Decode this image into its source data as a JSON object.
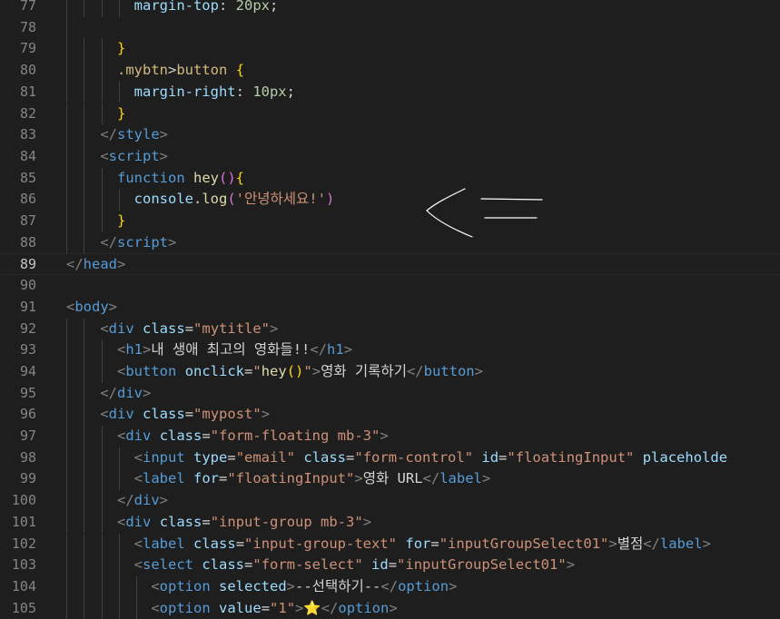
{
  "editor": {
    "active_line": 89,
    "lines": [
      {
        "n": "77",
        "tokens": [
          [
            "        ",
            "t-text"
          ],
          [
            "margin-top",
            "t-prop"
          ],
          [
            ": ",
            "t-text"
          ],
          [
            "20px",
            "t-num"
          ],
          [
            ";",
            "t-text"
          ]
        ]
      },
      {
        "n": "78",
        "tokens": []
      },
      {
        "n": "79",
        "tokens": [
          [
            "      ",
            "t-text"
          ],
          [
            "}",
            "t-brace"
          ]
        ]
      },
      {
        "n": "80",
        "tokens": [
          [
            "      ",
            "t-text"
          ],
          [
            ".mybtn",
            "t-sel"
          ],
          [
            ">",
            "t-text"
          ],
          [
            "button",
            "t-sel"
          ],
          [
            " ",
            "t-text"
          ],
          [
            "{",
            "t-brace"
          ]
        ]
      },
      {
        "n": "81",
        "tokens": [
          [
            "        ",
            "t-text"
          ],
          [
            "margin-right",
            "t-prop"
          ],
          [
            ": ",
            "t-text"
          ],
          [
            "10px",
            "t-num"
          ],
          [
            ";",
            "t-text"
          ]
        ]
      },
      {
        "n": "82",
        "tokens": [
          [
            "      ",
            "t-text"
          ],
          [
            "}",
            "t-brace"
          ]
        ]
      },
      {
        "n": "83",
        "tokens": [
          [
            "    ",
            "t-text"
          ],
          [
            "</",
            "t-punc"
          ],
          [
            "style",
            "t-tag"
          ],
          [
            ">",
            "t-punc"
          ]
        ]
      },
      {
        "n": "84",
        "tokens": [
          [
            "    ",
            "t-text"
          ],
          [
            "<",
            "t-punc"
          ],
          [
            "script",
            "t-tag"
          ],
          [
            ">",
            "t-punc"
          ]
        ]
      },
      {
        "n": "85",
        "tokens": [
          [
            "      ",
            "t-text"
          ],
          [
            "function",
            "t-kw"
          ],
          [
            " ",
            "t-text"
          ],
          [
            "hey",
            "t-fn"
          ],
          [
            "()",
            "t-paren"
          ],
          [
            "{",
            "t-brace"
          ]
        ]
      },
      {
        "n": "86",
        "tokens": [
          [
            "        ",
            "t-text"
          ],
          [
            "console",
            "t-var"
          ],
          [
            ".",
            "t-text"
          ],
          [
            "log",
            "t-fn"
          ],
          [
            "(",
            "t-paren"
          ],
          [
            "'안녕하세요!'",
            "t-str"
          ],
          [
            ")",
            "t-paren"
          ]
        ]
      },
      {
        "n": "87",
        "tokens": [
          [
            "      ",
            "t-text"
          ],
          [
            "}",
            "t-brace"
          ]
        ]
      },
      {
        "n": "88",
        "tokens": [
          [
            "    ",
            "t-text"
          ],
          [
            "</",
            "t-punc"
          ],
          [
            "script",
            "t-tag"
          ],
          [
            ">",
            "t-punc"
          ]
        ]
      },
      {
        "n": "89",
        "tokens": [
          [
            "</",
            "t-punc"
          ],
          [
            "head",
            "t-tag"
          ],
          [
            ">",
            "t-punc"
          ]
        ]
      },
      {
        "n": "90",
        "tokens": []
      },
      {
        "n": "91",
        "tokens": [
          [
            "<",
            "t-punc"
          ],
          [
            "body",
            "t-tag"
          ],
          [
            ">",
            "t-punc"
          ]
        ]
      },
      {
        "n": "92",
        "tokens": [
          [
            "    ",
            "t-text"
          ],
          [
            "<",
            "t-punc"
          ],
          [
            "div",
            "t-tag"
          ],
          [
            " ",
            "t-text"
          ],
          [
            "class",
            "t-attr"
          ],
          [
            "=",
            "t-text"
          ],
          [
            "\"mytitle\"",
            "t-str"
          ],
          [
            ">",
            "t-punc"
          ]
        ]
      },
      {
        "n": "93",
        "tokens": [
          [
            "      ",
            "t-text"
          ],
          [
            "<",
            "t-punc"
          ],
          [
            "h1",
            "t-tag"
          ],
          [
            ">",
            "t-punc"
          ],
          [
            "내 생애 최고의 영화들!!",
            "t-text"
          ],
          [
            "</",
            "t-punc"
          ],
          [
            "h1",
            "t-tag"
          ],
          [
            ">",
            "t-punc"
          ]
        ]
      },
      {
        "n": "94",
        "tokens": [
          [
            "      ",
            "t-text"
          ],
          [
            "<",
            "t-punc"
          ],
          [
            "button",
            "t-tag"
          ],
          [
            " ",
            "t-text"
          ],
          [
            "onclick",
            "t-attr"
          ],
          [
            "=",
            "t-text"
          ],
          [
            "\"",
            "t-str"
          ],
          [
            "hey",
            "t-fn"
          ],
          [
            "()",
            "t-brace"
          ],
          [
            "\"",
            "t-str"
          ],
          [
            ">",
            "t-punc"
          ],
          [
            "영화 기록하기",
            "t-text"
          ],
          [
            "</",
            "t-punc"
          ],
          [
            "button",
            "t-tag"
          ],
          [
            ">",
            "t-punc"
          ]
        ]
      },
      {
        "n": "95",
        "tokens": [
          [
            "    ",
            "t-text"
          ],
          [
            "</",
            "t-punc"
          ],
          [
            "div",
            "t-tag"
          ],
          [
            ">",
            "t-punc"
          ]
        ]
      },
      {
        "n": "96",
        "tokens": [
          [
            "    ",
            "t-text"
          ],
          [
            "<",
            "t-punc"
          ],
          [
            "div",
            "t-tag"
          ],
          [
            " ",
            "t-text"
          ],
          [
            "class",
            "t-attr"
          ],
          [
            "=",
            "t-text"
          ],
          [
            "\"mypost\"",
            "t-str"
          ],
          [
            ">",
            "t-punc"
          ]
        ]
      },
      {
        "n": "97",
        "tokens": [
          [
            "      ",
            "t-text"
          ],
          [
            "<",
            "t-punc"
          ],
          [
            "div",
            "t-tag"
          ],
          [
            " ",
            "t-text"
          ],
          [
            "class",
            "t-attr"
          ],
          [
            "=",
            "t-text"
          ],
          [
            "\"form-floating mb-3\"",
            "t-str"
          ],
          [
            ">",
            "t-punc"
          ]
        ]
      },
      {
        "n": "98",
        "tokens": [
          [
            "        ",
            "t-text"
          ],
          [
            "<",
            "t-punc"
          ],
          [
            "input",
            "t-tag"
          ],
          [
            " ",
            "t-text"
          ],
          [
            "type",
            "t-attr"
          ],
          [
            "=",
            "t-text"
          ],
          [
            "\"email\"",
            "t-str"
          ],
          [
            " ",
            "t-text"
          ],
          [
            "class",
            "t-attr"
          ],
          [
            "=",
            "t-text"
          ],
          [
            "\"form-control\"",
            "t-str"
          ],
          [
            " ",
            "t-text"
          ],
          [
            "id",
            "t-attr"
          ],
          [
            "=",
            "t-text"
          ],
          [
            "\"floatingInput\"",
            "t-str"
          ],
          [
            " ",
            "t-text"
          ],
          [
            "placeholde",
            "t-attr"
          ]
        ]
      },
      {
        "n": "99",
        "tokens": [
          [
            "        ",
            "t-text"
          ],
          [
            "<",
            "t-punc"
          ],
          [
            "label",
            "t-tag"
          ],
          [
            " ",
            "t-text"
          ],
          [
            "for",
            "t-attr"
          ],
          [
            "=",
            "t-text"
          ],
          [
            "\"floatingInput\"",
            "t-str"
          ],
          [
            ">",
            "t-punc"
          ],
          [
            "영화 URL",
            "t-text"
          ],
          [
            "</",
            "t-punc"
          ],
          [
            "label",
            "t-tag"
          ],
          [
            ">",
            "t-punc"
          ]
        ]
      },
      {
        "n": "100",
        "tokens": [
          [
            "      ",
            "t-text"
          ],
          [
            "</",
            "t-punc"
          ],
          [
            "div",
            "t-tag"
          ],
          [
            ">",
            "t-punc"
          ]
        ]
      },
      {
        "n": "101",
        "tokens": [
          [
            "      ",
            "t-text"
          ],
          [
            "<",
            "t-punc"
          ],
          [
            "div",
            "t-tag"
          ],
          [
            " ",
            "t-text"
          ],
          [
            "class",
            "t-attr"
          ],
          [
            "=",
            "t-text"
          ],
          [
            "\"input-group mb-3\"",
            "t-str"
          ],
          [
            ">",
            "t-punc"
          ]
        ]
      },
      {
        "n": "102",
        "tokens": [
          [
            "        ",
            "t-text"
          ],
          [
            "<",
            "t-punc"
          ],
          [
            "label",
            "t-tag"
          ],
          [
            " ",
            "t-text"
          ],
          [
            "class",
            "t-attr"
          ],
          [
            "=",
            "t-text"
          ],
          [
            "\"input-group-text\"",
            "t-str"
          ],
          [
            " ",
            "t-text"
          ],
          [
            "for",
            "t-attr"
          ],
          [
            "=",
            "t-text"
          ],
          [
            "\"inputGroupSelect01\"",
            "t-str"
          ],
          [
            ">",
            "t-punc"
          ],
          [
            "별점",
            "t-text"
          ],
          [
            "</",
            "t-punc"
          ],
          [
            "label",
            "t-tag"
          ],
          [
            ">",
            "t-punc"
          ]
        ]
      },
      {
        "n": "103",
        "tokens": [
          [
            "        ",
            "t-text"
          ],
          [
            "<",
            "t-punc"
          ],
          [
            "select",
            "t-tag"
          ],
          [
            " ",
            "t-text"
          ],
          [
            "class",
            "t-attr"
          ],
          [
            "=",
            "t-text"
          ],
          [
            "\"form-select\"",
            "t-str"
          ],
          [
            " ",
            "t-text"
          ],
          [
            "id",
            "t-attr"
          ],
          [
            "=",
            "t-text"
          ],
          [
            "\"inputGroupSelect01\"",
            "t-str"
          ],
          [
            ">",
            "t-punc"
          ]
        ]
      },
      {
        "n": "104",
        "tokens": [
          [
            "          ",
            "t-text"
          ],
          [
            "<",
            "t-punc"
          ],
          [
            "option",
            "t-tag"
          ],
          [
            " ",
            "t-text"
          ],
          [
            "selected",
            "t-attr"
          ],
          [
            ">",
            "t-punc"
          ],
          [
            "--선택하기--",
            "t-text"
          ],
          [
            "</",
            "t-punc"
          ],
          [
            "option",
            "t-tag"
          ],
          [
            ">",
            "t-punc"
          ]
        ]
      },
      {
        "n": "105",
        "tokens": [
          [
            "          ",
            "t-text"
          ],
          [
            "<",
            "t-punc"
          ],
          [
            "option",
            "t-tag"
          ],
          [
            " ",
            "t-text"
          ],
          [
            "value",
            "t-attr"
          ],
          [
            "=",
            "t-text"
          ],
          [
            "\"1\"",
            "t-str"
          ],
          [
            ">",
            "t-punc"
          ],
          [
            "⭐",
            "emoji"
          ],
          [
            "</",
            "t-punc"
          ],
          [
            "option",
            "t-tag"
          ],
          [
            ">",
            "t-punc"
          ]
        ]
      }
    ]
  },
  "annotation": {
    "icon": "arrow-left-hand-drawn-icon",
    "color": "#ffffff"
  }
}
